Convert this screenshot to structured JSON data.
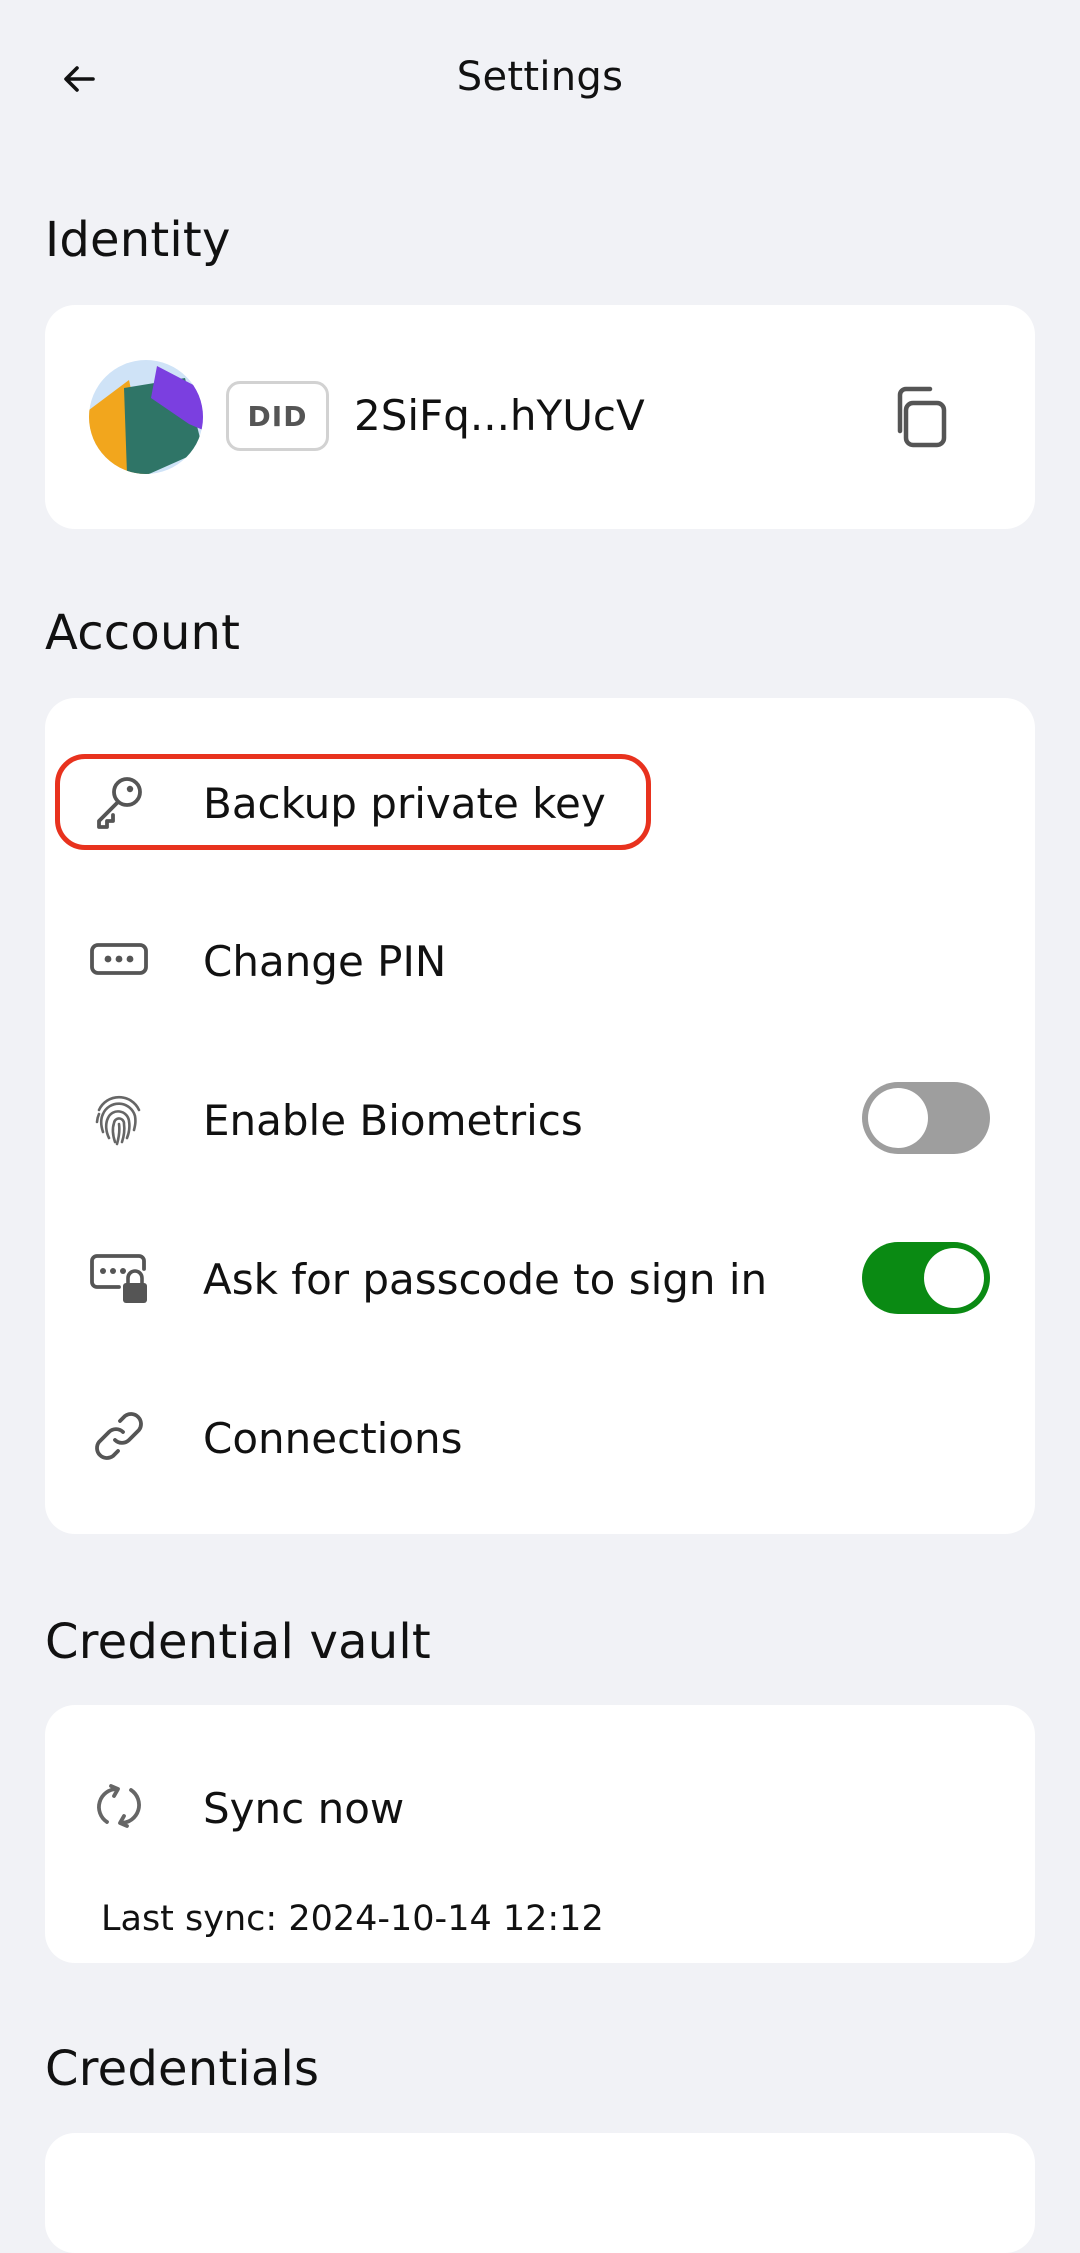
{
  "header": {
    "title": "Settings",
    "back_icon": "arrow-left-icon"
  },
  "identity": {
    "section_title": "Identity",
    "avatar_icon": "avatar-identicon",
    "did_badge": "DID",
    "did_value": "2SiFq...hYUcV",
    "copy_icon": "copy-icon"
  },
  "account": {
    "section_title": "Account",
    "items": [
      {
        "label": "Backup private key",
        "icon": "key-icon"
      },
      {
        "label": "Change PIN",
        "icon": "pin-icon"
      },
      {
        "label": "Enable Biometrics",
        "icon": "fingerprint-icon",
        "toggle": false
      },
      {
        "label": "Ask for passcode to sign in",
        "icon": "passcode-lock-icon",
        "toggle": true
      },
      {
        "label": "Connections",
        "icon": "link-icon"
      }
    ]
  },
  "credential_vault": {
    "section_title": "Credential vault",
    "sync_label": "Sync now",
    "sync_icon": "sync-icon",
    "last_sync": "Last sync: 2024-10-14 12:12"
  },
  "credentials": {
    "section_title": "Credentials"
  },
  "colors": {
    "background": "#f1f2f6",
    "card": "#ffffff",
    "toggle_on": "#0a8a13",
    "toggle_off": "#9e9e9e",
    "highlight": "#e8321e"
  }
}
